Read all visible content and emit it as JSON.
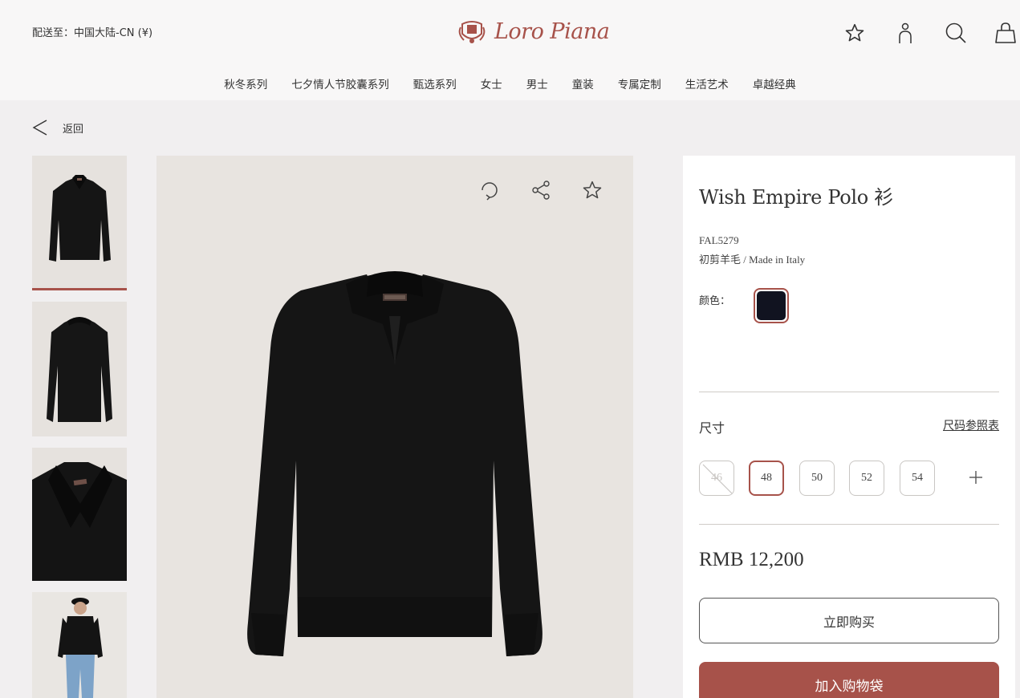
{
  "header": {
    "ship_to": "配送至：中国大陆-CN (¥)",
    "brand": "Loro Piana",
    "icons": [
      "star-icon",
      "user-icon",
      "search-icon",
      "bag-icon"
    ]
  },
  "nav": {
    "items": [
      {
        "label": "秋冬系列"
      },
      {
        "label": "七夕情人节胶囊系列"
      },
      {
        "label": "甄选系列"
      },
      {
        "label": "女士"
      },
      {
        "label": "男士"
      },
      {
        "label": "童装"
      },
      {
        "label": "专属定制"
      },
      {
        "label": "生活艺术"
      },
      {
        "label": "卓越经典"
      }
    ]
  },
  "back": {
    "label": "返回"
  },
  "gallery": {
    "thumbnails": [
      "front",
      "back",
      "collar-detail",
      "model"
    ],
    "active_index": 0,
    "actions": [
      "rotate-360-icon",
      "share-icon",
      "favorite-star-icon"
    ]
  },
  "product": {
    "title": "Wish Empire Polo 衫",
    "code": "FAL5279",
    "material_cn": "初剪羊毛",
    "material_sep": " / ",
    "material_en": "Made in Italy",
    "color_label": "颜色：",
    "color_swatch": "#111320",
    "size_label": "尺寸",
    "size_guide": "尺码参照表",
    "sizes": [
      {
        "label": "46",
        "state": "unavailable"
      },
      {
        "label": "48",
        "state": "selected"
      },
      {
        "label": "50",
        "state": "available"
      },
      {
        "label": "52",
        "state": "available"
      },
      {
        "label": "54",
        "state": "available"
      }
    ],
    "price": "RMB 12,200",
    "buy_now": "立即购买",
    "add_to_bag": "加入购物袋"
  },
  "colors": {
    "accent": "#a7524a",
    "header_bg": "#f8f7f7",
    "page_bg": "#f1eff0"
  }
}
